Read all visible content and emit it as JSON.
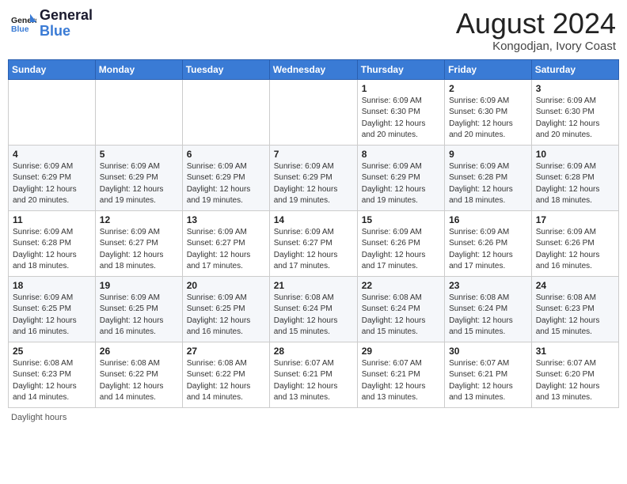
{
  "header": {
    "logo_line1": "General",
    "logo_line2": "Blue",
    "main_title": "August 2024",
    "subtitle": "Kongodjan, Ivory Coast"
  },
  "days_of_week": [
    "Sunday",
    "Monday",
    "Tuesday",
    "Wednesday",
    "Thursday",
    "Friday",
    "Saturday"
  ],
  "weeks": [
    [
      {
        "day": "",
        "info": ""
      },
      {
        "day": "",
        "info": ""
      },
      {
        "day": "",
        "info": ""
      },
      {
        "day": "",
        "info": ""
      },
      {
        "day": "1",
        "info": "Sunrise: 6:09 AM\nSunset: 6:30 PM\nDaylight: 12 hours\nand 20 minutes."
      },
      {
        "day": "2",
        "info": "Sunrise: 6:09 AM\nSunset: 6:30 PM\nDaylight: 12 hours\nand 20 minutes."
      },
      {
        "day": "3",
        "info": "Sunrise: 6:09 AM\nSunset: 6:30 PM\nDaylight: 12 hours\nand 20 minutes."
      }
    ],
    [
      {
        "day": "4",
        "info": "Sunrise: 6:09 AM\nSunset: 6:29 PM\nDaylight: 12 hours\nand 20 minutes."
      },
      {
        "day": "5",
        "info": "Sunrise: 6:09 AM\nSunset: 6:29 PM\nDaylight: 12 hours\nand 19 minutes."
      },
      {
        "day": "6",
        "info": "Sunrise: 6:09 AM\nSunset: 6:29 PM\nDaylight: 12 hours\nand 19 minutes."
      },
      {
        "day": "7",
        "info": "Sunrise: 6:09 AM\nSunset: 6:29 PM\nDaylight: 12 hours\nand 19 minutes."
      },
      {
        "day": "8",
        "info": "Sunrise: 6:09 AM\nSunset: 6:29 PM\nDaylight: 12 hours\nand 19 minutes."
      },
      {
        "day": "9",
        "info": "Sunrise: 6:09 AM\nSunset: 6:28 PM\nDaylight: 12 hours\nand 18 minutes."
      },
      {
        "day": "10",
        "info": "Sunrise: 6:09 AM\nSunset: 6:28 PM\nDaylight: 12 hours\nand 18 minutes."
      }
    ],
    [
      {
        "day": "11",
        "info": "Sunrise: 6:09 AM\nSunset: 6:28 PM\nDaylight: 12 hours\nand 18 minutes."
      },
      {
        "day": "12",
        "info": "Sunrise: 6:09 AM\nSunset: 6:27 PM\nDaylight: 12 hours\nand 18 minutes."
      },
      {
        "day": "13",
        "info": "Sunrise: 6:09 AM\nSunset: 6:27 PM\nDaylight: 12 hours\nand 17 minutes."
      },
      {
        "day": "14",
        "info": "Sunrise: 6:09 AM\nSunset: 6:27 PM\nDaylight: 12 hours\nand 17 minutes."
      },
      {
        "day": "15",
        "info": "Sunrise: 6:09 AM\nSunset: 6:26 PM\nDaylight: 12 hours\nand 17 minutes."
      },
      {
        "day": "16",
        "info": "Sunrise: 6:09 AM\nSunset: 6:26 PM\nDaylight: 12 hours\nand 17 minutes."
      },
      {
        "day": "17",
        "info": "Sunrise: 6:09 AM\nSunset: 6:26 PM\nDaylight: 12 hours\nand 16 minutes."
      }
    ],
    [
      {
        "day": "18",
        "info": "Sunrise: 6:09 AM\nSunset: 6:25 PM\nDaylight: 12 hours\nand 16 minutes."
      },
      {
        "day": "19",
        "info": "Sunrise: 6:09 AM\nSunset: 6:25 PM\nDaylight: 12 hours\nand 16 minutes."
      },
      {
        "day": "20",
        "info": "Sunrise: 6:09 AM\nSunset: 6:25 PM\nDaylight: 12 hours\nand 16 minutes."
      },
      {
        "day": "21",
        "info": "Sunrise: 6:08 AM\nSunset: 6:24 PM\nDaylight: 12 hours\nand 15 minutes."
      },
      {
        "day": "22",
        "info": "Sunrise: 6:08 AM\nSunset: 6:24 PM\nDaylight: 12 hours\nand 15 minutes."
      },
      {
        "day": "23",
        "info": "Sunrise: 6:08 AM\nSunset: 6:24 PM\nDaylight: 12 hours\nand 15 minutes."
      },
      {
        "day": "24",
        "info": "Sunrise: 6:08 AM\nSunset: 6:23 PM\nDaylight: 12 hours\nand 15 minutes."
      }
    ],
    [
      {
        "day": "25",
        "info": "Sunrise: 6:08 AM\nSunset: 6:23 PM\nDaylight: 12 hours\nand 14 minutes."
      },
      {
        "day": "26",
        "info": "Sunrise: 6:08 AM\nSunset: 6:22 PM\nDaylight: 12 hours\nand 14 minutes."
      },
      {
        "day": "27",
        "info": "Sunrise: 6:08 AM\nSunset: 6:22 PM\nDaylight: 12 hours\nand 14 minutes."
      },
      {
        "day": "28",
        "info": "Sunrise: 6:07 AM\nSunset: 6:21 PM\nDaylight: 12 hours\nand 13 minutes."
      },
      {
        "day": "29",
        "info": "Sunrise: 6:07 AM\nSunset: 6:21 PM\nDaylight: 12 hours\nand 13 minutes."
      },
      {
        "day": "30",
        "info": "Sunrise: 6:07 AM\nSunset: 6:21 PM\nDaylight: 12 hours\nand 13 minutes."
      },
      {
        "day": "31",
        "info": "Sunrise: 6:07 AM\nSunset: 6:20 PM\nDaylight: 12 hours\nand 13 minutes."
      }
    ]
  ],
  "footer": "Daylight hours"
}
